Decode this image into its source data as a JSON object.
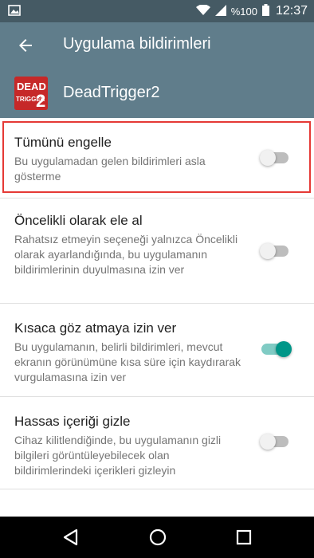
{
  "status_bar": {
    "battery": "%100",
    "time": "12:37",
    "icons": [
      "image-icon",
      "wifi-icon",
      "signal-icon",
      "battery-icon"
    ]
  },
  "toolbar": {
    "title": "Uygulama bildirimleri",
    "back_icon": "arrow-back-icon"
  },
  "app": {
    "name": "DeadTrigger2",
    "icon_lines": [
      "DEAD",
      "TRIGGER",
      "2"
    ]
  },
  "settings": [
    {
      "title": "Tümünü engelle",
      "description": "Bu uygulamadan gelen bildirimleri asla gösterme",
      "enabled": false
    },
    {
      "title": "Öncelikli olarak ele al",
      "description": "Rahatsız etmeyin seçeneği yalnızca Öncelikli olarak ayarlandığında, bu uygulamanın bildirimlerinin duyulmasına izin ver",
      "enabled": false
    },
    {
      "title": "Kısaca göz atmaya izin ver",
      "description": "Bu uygulamanın, belirli bildirimleri, mevcut ekranın görünümüne kısa süre için kaydırarak vurgulamasına izin ver",
      "enabled": true
    },
    {
      "title": "Hassas içeriği gizle",
      "description": "Cihaz kilitlendiğinde, bu uygulamanın gizli bilgileri görüntüleyebilecek olan bildirimlerindeki içerikleri gizleyin",
      "enabled": false
    }
  ],
  "colors": {
    "status_bar": "#455a64",
    "toolbar": "#607d8b",
    "accent": "#009688",
    "highlight": "#e53935"
  },
  "nav_bar": {
    "buttons": [
      "back-triangle-icon",
      "home-circle-icon",
      "recents-square-icon"
    ]
  }
}
